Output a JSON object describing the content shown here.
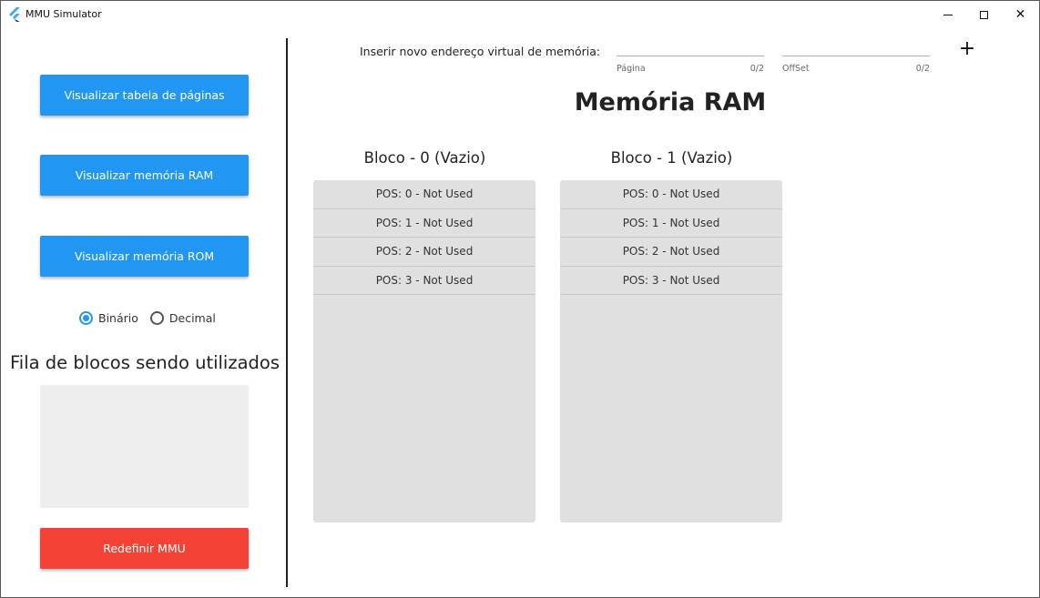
{
  "window": {
    "title": "MMU Simulator",
    "controls": {
      "minimize": "minimize-icon",
      "maximize": "maximize-icon",
      "close": "close-icon",
      "close_glyph": "✕"
    }
  },
  "sidebar": {
    "buttons": {
      "page_table": "Visualizar tabela de páginas",
      "ram": "Visualizar memória RAM",
      "rom": "Visualizar memória ROM",
      "reset": "Redefinir MMU"
    },
    "format": {
      "options": [
        "Binário",
        "Decimal"
      ],
      "selected": "Binário"
    },
    "queue_title": "Fila de blocos sendo utilizados"
  },
  "address_input": {
    "label": "Inserir novo endereço virtual de memória:",
    "page": {
      "value": "",
      "hint": "Página",
      "counter": "0/2"
    },
    "offset": {
      "value": "",
      "hint": "OffSet",
      "counter": "0/2"
    },
    "add_glyph": "+"
  },
  "main": {
    "title": "Memória RAM",
    "blocks": [
      {
        "title": "Bloco - 0 (Vazio)",
        "rows": [
          "POS: 0 - Not Used",
          "POS: 1 - Not Used",
          "POS: 2 - Not Used",
          "POS: 3 - Not Used"
        ]
      },
      {
        "title": "Bloco - 1 (Vazio)",
        "rows": [
          "POS: 0 - Not Used",
          "POS: 1 - Not Used",
          "POS: 2 - Not Used",
          "POS: 3 - Not Used"
        ]
      }
    ]
  },
  "colors": {
    "primary": "#2196f3",
    "danger": "#f44336",
    "block_bg": "#e0e0e0",
    "queue_bg": "#eeeeee"
  }
}
